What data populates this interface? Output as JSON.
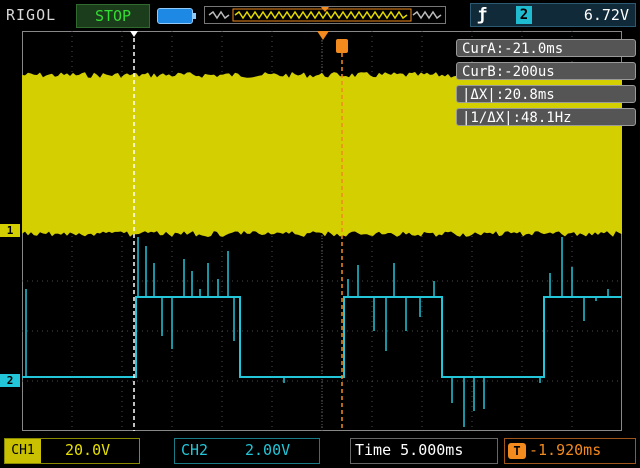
{
  "header": {
    "brand": "RIGOL",
    "run_state": "STOP",
    "trigger": {
      "slope_icon": "rising-edge-icon",
      "source": "2",
      "level": "6.72V"
    }
  },
  "cursors": {
    "cur_a": "CurA:-21.0ms",
    "cur_b": "CurB:-200us",
    "delta_x": "|ΔX|:20.8ms",
    "inv_delta_x": "|1/ΔX|:48.1Hz"
  },
  "channels": {
    "ch1": {
      "label": "CH1",
      "marker": "1",
      "scale": "20.0V",
      "color": "#d4cf00"
    },
    "ch2": {
      "label": "CH2",
      "marker": "2",
      "scale": "2.00V",
      "color": "#22c6d8"
    }
  },
  "footer": {
    "timebase": "Time 5.000ms",
    "trigger_offset": "-1.920ms"
  },
  "colors": {
    "cursor_a": "#ffffff",
    "cursor_b": "#f28a1e",
    "grid": "#4a4a4a"
  }
}
